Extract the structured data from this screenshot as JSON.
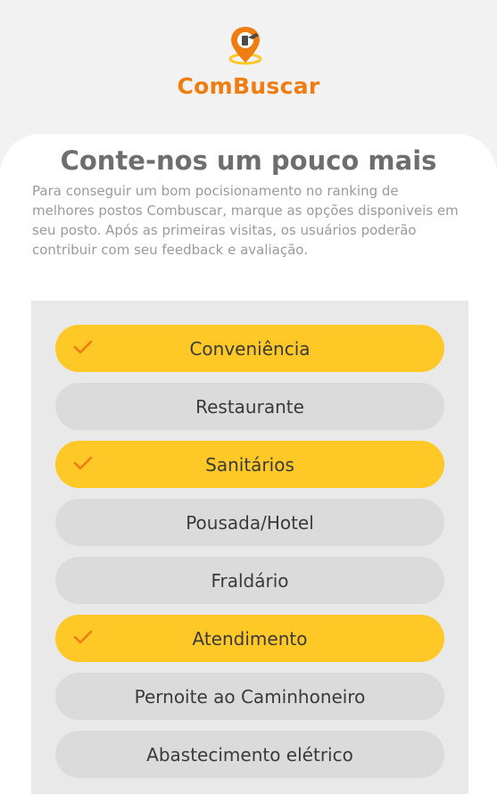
{
  "brand": {
    "name": "ComBuscar"
  },
  "form": {
    "title": "Conte-nos um pouco mais",
    "description": "Para conseguir um bom pocisionamento no ranking de melhores postos Combuscar, marque as opções disponiveis em seu posto. Após as primeiras visitas, os usuários poderão contribuir com seu feedback e avaliação."
  },
  "options": [
    {
      "label": "Conveniência",
      "selected": true
    },
    {
      "label": "Restaurante",
      "selected": false
    },
    {
      "label": "Sanitários",
      "selected": true
    },
    {
      "label": "Pousada/Hotel",
      "selected": false
    },
    {
      "label": "Fraldário",
      "selected": false
    },
    {
      "label": "Atendimento",
      "selected": true
    },
    {
      "label": "Pernoite ao Caminhoneiro",
      "selected": false
    },
    {
      "label": "Abastecimento elétrico",
      "selected": false
    }
  ],
  "colors": {
    "brand": "#f07d12",
    "selected": "#fec827",
    "unselected": "#dbdbdb",
    "check": "#f07d12"
  },
  "icons": {
    "logo": "fuel-pin-icon",
    "check": "check-icon"
  }
}
